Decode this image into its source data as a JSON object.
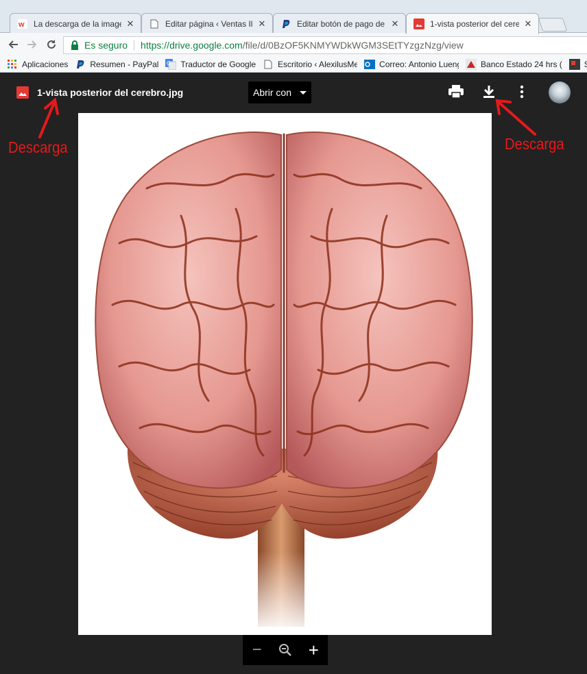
{
  "tabs": [
    {
      "title": "La descarga de la imagen",
      "icon": "wix-favicon-icon",
      "active": false
    },
    {
      "title": "Editar página ‹ Ventas Ilu",
      "icon": "page-icon",
      "active": false
    },
    {
      "title": "Editar botón de pago de",
      "icon": "paypal-icon",
      "active": false
    },
    {
      "title": "1-vista posterior del cere",
      "icon": "image-file-icon",
      "active": true
    }
  ],
  "close_glyph": "✕",
  "address": {
    "secure_label": "Es seguro",
    "url_host": "https://drive.google.com",
    "url_path": "/file/d/0BzOF5KNMYWDkWGM3SEtTYzgzNzg/view"
  },
  "bookmarks": [
    {
      "label": "Aplicaciones",
      "icon": "apps-grid-icon"
    },
    {
      "label": "Resumen - PayPal",
      "icon": "paypal-icon"
    },
    {
      "label": "Traductor de Google",
      "icon": "google-translate-icon"
    },
    {
      "label": "Escritorio ‹ AlexilusMe",
      "icon": "page-icon"
    },
    {
      "label": "Correo: Antonio Lueng",
      "icon": "outlook-icon"
    },
    {
      "label": "Banco Estado 24 hrs (",
      "icon": "bank-icon"
    },
    {
      "label": "S",
      "icon": "bookmark-favicon-icon"
    }
  ],
  "viewer": {
    "file_name": "1-vista posterior del cerebro.jpg",
    "open_with_label": "Abrir con",
    "zoom_out_glyph": "−",
    "zoom_in_glyph": "+"
  },
  "annotations": {
    "left_label": "Descarga",
    "right_label": "Descarga"
  },
  "colors": {
    "viewer_bg": "#222222",
    "annotation_red": "#e5191b",
    "secure_green": "#0b8043",
    "file_icon_red": "#e53935"
  }
}
